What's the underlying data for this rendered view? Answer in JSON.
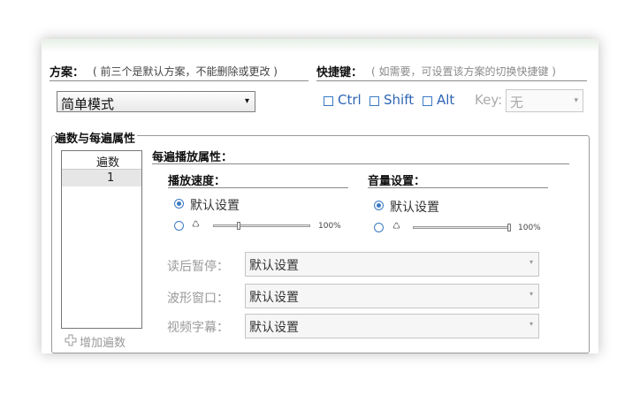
{
  "scheme": {
    "title": "方案：",
    "note": "( 前三个是默认方案，不能删除或更改 )",
    "selected": "简单模式",
    "arrow": "▾"
  },
  "shortcut": {
    "title": "快捷键：",
    "note": "( 如需要，可设置该方案的切换快捷键 )",
    "ctrl_label": "Ctrl",
    "shift_label": "Shift",
    "alt_label": "Alt",
    "key_label": "Key:",
    "key_value": "无",
    "key_arrow": "▾"
  },
  "passes": {
    "group_title": "遍数与每遍属性",
    "list_header": "遍数",
    "rows": [
      "1"
    ],
    "add_label": "增加遍数",
    "add_icon": "plus-icon"
  },
  "pass_props": {
    "title": "每遍播放属性：",
    "speed": {
      "title": "播放速度：",
      "default_label": "默认设置",
      "custom_icon": "recycle-icon",
      "percent": "100%",
      "value": 0.25
    },
    "volume": {
      "title": "音量设置：",
      "default_label": "默认设置",
      "custom_icon": "recycle-icon",
      "percent": "100%",
      "value": 1.0
    },
    "fields": [
      {
        "label": "读后暂停：",
        "value": "默认设置"
      },
      {
        "label": "波形窗口：",
        "value": "默认设置"
      },
      {
        "label": "视频字幕：",
        "value": "默认设置"
      }
    ],
    "combo_arrow": "▾"
  }
}
